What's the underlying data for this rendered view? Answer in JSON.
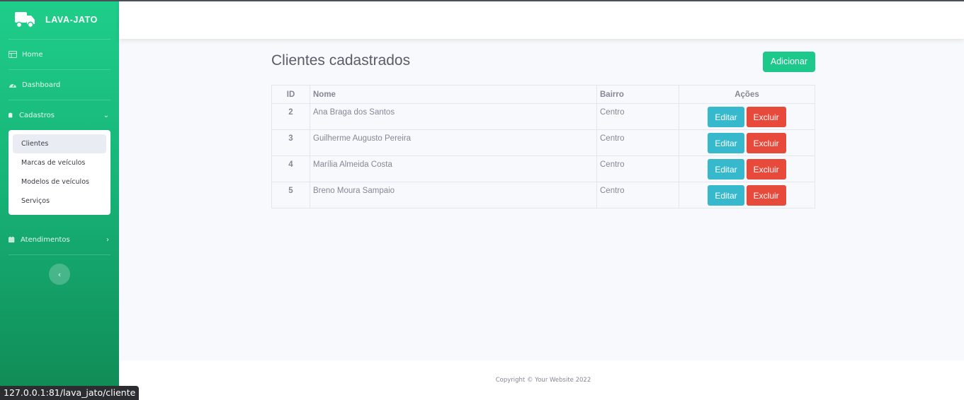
{
  "brand": {
    "name": "LAVA-JATO",
    "icon": "truck-icon"
  },
  "sidebar": {
    "home": {
      "label": "Home",
      "icon": "table-icon"
    },
    "dashboard": {
      "label": "Dashboard",
      "icon": "gauge-icon"
    },
    "cadastros": {
      "label": "Cadastros",
      "icon": "clipboard-icon",
      "items": [
        {
          "label": "Clientes",
          "active": true
        },
        {
          "label": "Marcas de veículos"
        },
        {
          "label": "Modelos de veículos"
        },
        {
          "label": "Serviços"
        }
      ]
    },
    "atendimentos": {
      "label": "Atendimentos",
      "icon": "calendar-icon"
    },
    "toggle_icon": "chevron-left-icon"
  },
  "main": {
    "title": "Clientes cadastrados",
    "add_label": "Adicionar",
    "columns": {
      "id": "ID",
      "nome": "Nome",
      "bairro": "Bairro",
      "acoes": "Ações"
    },
    "rows": [
      {
        "id": "2",
        "nome": "Ana Braga dos Santos",
        "bairro": "Centro"
      },
      {
        "id": "3",
        "nome": "Guilherme Augusto Pereira",
        "bairro": "Centro"
      },
      {
        "id": "4",
        "nome": "Marília Almeida Costa",
        "bairro": "Centro"
      },
      {
        "id": "5",
        "nome": "Breno Moura Sampaio",
        "bairro": "Centro"
      }
    ],
    "edit_label": "Editar",
    "delete_label": "Excluir"
  },
  "footer": {
    "copyright": "Copyright © Your Website 2022"
  },
  "status_url": "127.0.0.1:81/lava_jato/cliente",
  "colors": {
    "primary": "#1cc88a",
    "info": "#36b9cc",
    "danger": "#e74a3b",
    "text": "#858796"
  }
}
